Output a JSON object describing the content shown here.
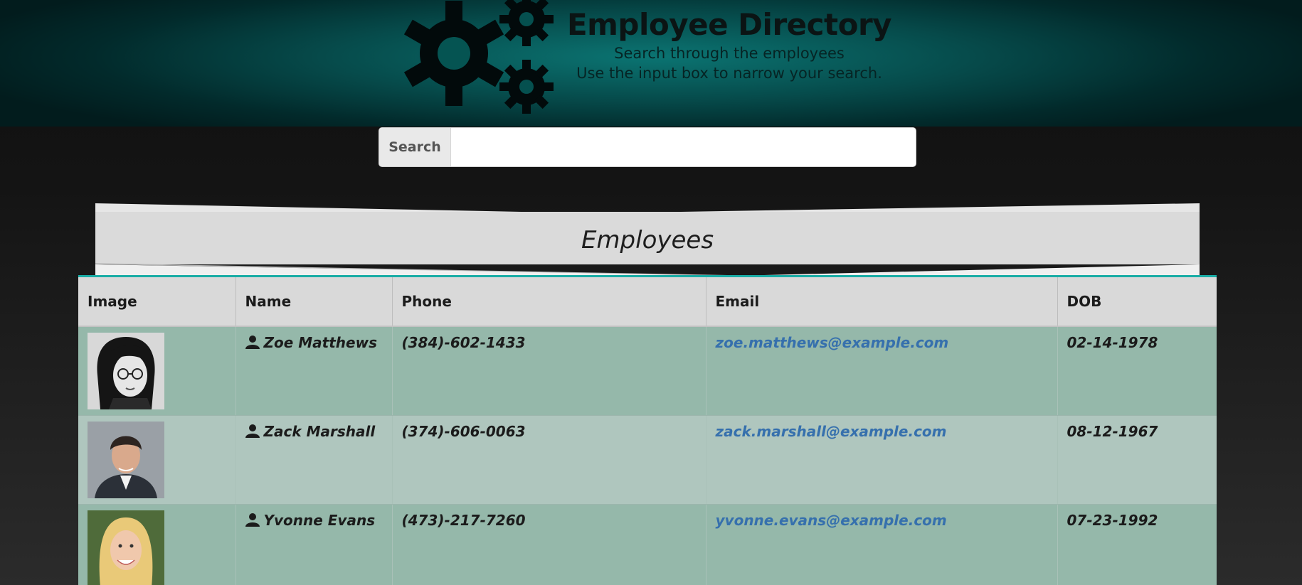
{
  "header": {
    "title": "Employee Directory",
    "subtitle_line1": "Search through the employees",
    "subtitle_line2": "Use the input box to narrow your search."
  },
  "search": {
    "label": "Search",
    "value": "",
    "placeholder": ""
  },
  "section": {
    "title": "Employees"
  },
  "table": {
    "columns": [
      "Image",
      "Name",
      "Phone",
      "Email",
      "DOB"
    ],
    "rows": [
      {
        "name": "Zoe Matthews",
        "phone": "(384)-602-1433",
        "email": "zoe.matthews@example.com",
        "dob": "02-14-1978",
        "avatar_icon": "woman-portrait-icon"
      },
      {
        "name": "Zack Marshall",
        "phone": "(374)-606-0063",
        "email": "zack.marshall@example.com",
        "dob": "08-12-1967",
        "avatar_icon": "man-portrait-icon"
      },
      {
        "name": "Yvonne Evans",
        "phone": "(473)-217-7260",
        "email": "yvonne.evans@example.com",
        "dob": "07-23-1992",
        "avatar_icon": "woman-portrait-icon"
      }
    ]
  },
  "colors": {
    "header_teal": "#0b7472",
    "row_odd": "#95b8aa",
    "row_even": "#afc6be",
    "link": "#3670ad",
    "accent_border": "#1aada6"
  }
}
